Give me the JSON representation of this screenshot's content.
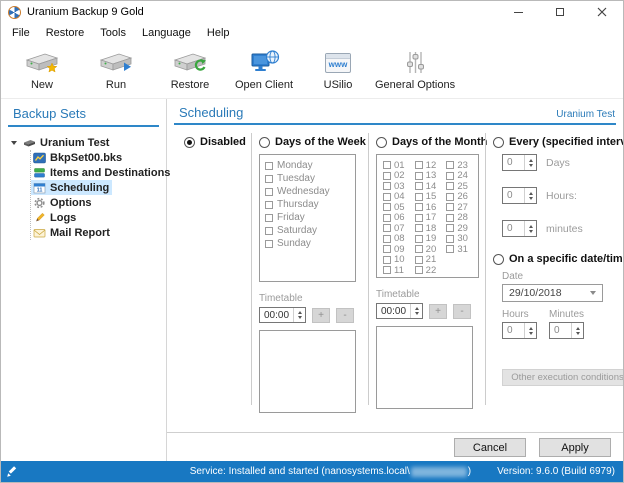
{
  "window": {
    "title": "Uranium Backup 9 Gold"
  },
  "menu": {
    "items": [
      "File",
      "Restore",
      "Tools",
      "Language",
      "Help"
    ]
  },
  "toolbar": {
    "items": [
      {
        "label": "New",
        "icon": "drive-new-icon"
      },
      {
        "label": "Run",
        "icon": "drive-run-icon"
      },
      {
        "label": "Restore",
        "icon": "drive-restore-icon"
      },
      {
        "label": "Open Client",
        "icon": "monitor-globe-icon"
      },
      {
        "label": "USilio",
        "icon": "www-browser-icon"
      },
      {
        "label": "General Options",
        "icon": "sliders-icon"
      }
    ],
    "usilio_icon_text": "www"
  },
  "sidebar": {
    "title": "Backup Sets",
    "tree": {
      "root": "Uranium Test",
      "children": [
        {
          "label": "BkpSet00.bks",
          "icon": "chart-icon"
        },
        {
          "label": "Items and Destinations",
          "icon": "items-icon"
        },
        {
          "label": "Scheduling",
          "icon": "calendar-icon",
          "selected": true
        },
        {
          "label": "Options",
          "icon": "gear-icon"
        },
        {
          "label": "Logs",
          "icon": "pencil-icon"
        },
        {
          "label": "Mail Report",
          "icon": "mail-icon"
        }
      ]
    }
  },
  "main": {
    "title": "Scheduling",
    "context_label": "Uranium Test",
    "disabled": {
      "label": "Disabled",
      "selected": true
    },
    "week": {
      "label": "Days of the Week",
      "days": [
        "Monday",
        "Tuesday",
        "Wednesday",
        "Thursday",
        "Friday",
        "Saturday",
        "Sunday"
      ],
      "timetable": {
        "label": "Timetable",
        "value": "00:00",
        "add": "+",
        "remove": "-"
      }
    },
    "month": {
      "label": "Days of the Month",
      "days": [
        "01",
        "02",
        "03",
        "04",
        "05",
        "06",
        "07",
        "08",
        "09",
        "10",
        "11",
        "12",
        "13",
        "14",
        "15",
        "16",
        "17",
        "18",
        "19",
        "20",
        "21",
        "22",
        "23",
        "24",
        "25",
        "26",
        "27",
        "28",
        "29",
        "30",
        "31"
      ],
      "timetable": {
        "label": "Timetable",
        "value": "00:00",
        "add": "+",
        "remove": "-"
      }
    },
    "interval": {
      "label": "Every (specified interval)",
      "fields": [
        {
          "value": "0",
          "label": "Days"
        },
        {
          "value": "0",
          "label": "Hours:"
        },
        {
          "value": "0",
          "label": "minutes"
        }
      ]
    },
    "specific": {
      "label": "On a specific date/time",
      "date_label": "Date",
      "date_value": "29/10/2018",
      "hours_label": "Hours",
      "minutes_label": "Minutes",
      "hours_value": "0",
      "minutes_value": "0",
      "other_button": "Other execution conditions"
    },
    "footer": {
      "cancel": "Cancel",
      "apply": "Apply"
    }
  },
  "statusbar": {
    "service_prefix": "Service: Installed and started (nanosystems.local\\",
    "service_suffix": ")",
    "version": "Version: 9.6.0 (Build 6979)"
  },
  "colors": {
    "accent_blue": "#2a7ab8",
    "rule_blue": "#2e87c8",
    "statusbar_bg": "#1878c2",
    "tree_selection_bg": "#cce8ff"
  }
}
